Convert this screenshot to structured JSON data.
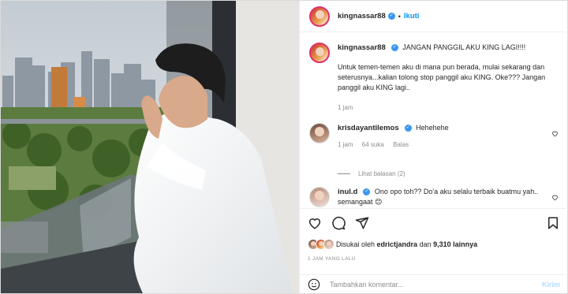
{
  "post": {
    "username": "kingnassar88",
    "follow_label": "Ikuti",
    "dot": "•"
  },
  "caption": {
    "username": "kingnassar88",
    "headline": "JANGAN PANGGIL AKU KING LAGI!!!!",
    "body": "Untuk temen-temen aku di mana pun berada, mulai sekarang dan seterusnya...kalian tolong stop panggil aku KING. Oke??? Jangan panggil aku KING lagi..",
    "time": "1 jam"
  },
  "comments": [
    {
      "username": "krisdayantilemos",
      "text": "Hehehehe",
      "time": "1 jam",
      "likes": "64 suka",
      "reply_label": "Balas",
      "view_replies": "Lihat balasan (2)"
    },
    {
      "username": "inul.d",
      "text": "Ono opo toh?? Do'a aku selalu terbaik buatmu yah.. semangaat 😊"
    }
  ],
  "likes": {
    "prefix": "Disukai oleh",
    "user": "edrictjandra",
    "conj": "dan",
    "count": "9,310 lainnya"
  },
  "timestamp": "1 JAM YANG LALU",
  "composer": {
    "placeholder": "Tambahkan komentar...",
    "send_label": "Kirim"
  },
  "icons": {
    "like": "heart-icon",
    "comment": "comment-icon",
    "share": "paper-plane-icon",
    "save": "bookmark-icon",
    "emoji": "emoji-icon",
    "verified": "verified-badge-icon"
  },
  "colors": {
    "accent": "#0095f6",
    "verified": "#3897f0",
    "muted": "#8e8e8e",
    "send_disabled": "#b2dffc"
  }
}
